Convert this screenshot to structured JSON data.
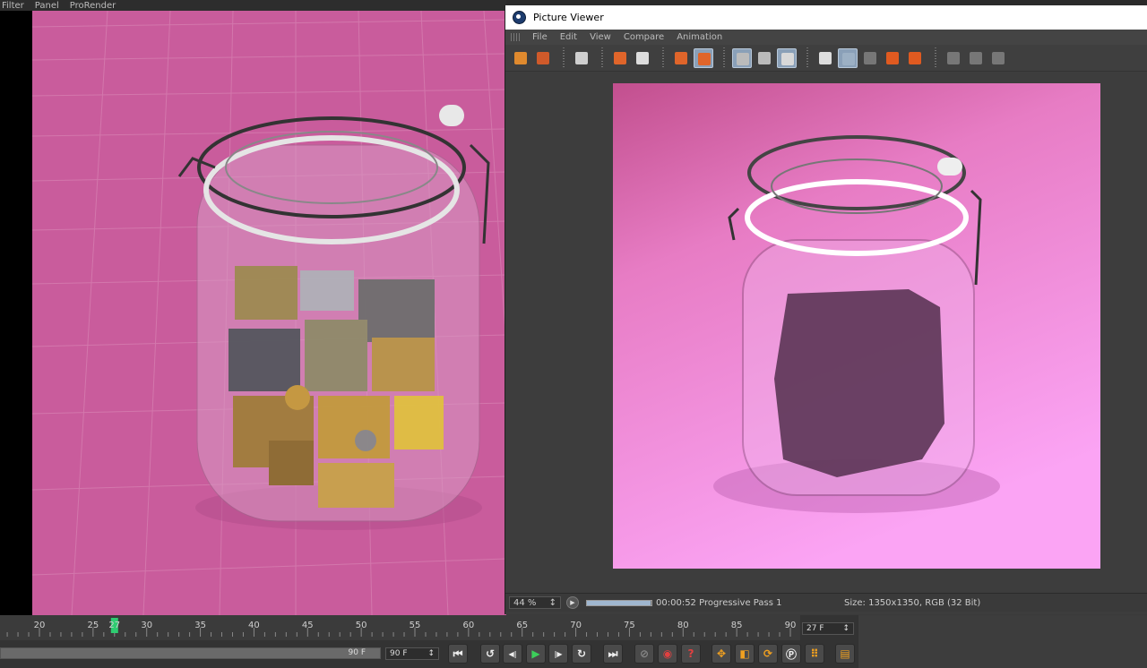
{
  "left_menu": [
    "Filter",
    "Panel",
    "ProRender"
  ],
  "picture_viewer": {
    "title": "Picture Viewer",
    "menu": [
      "File",
      "Edit",
      "View",
      "Compare",
      "Animation"
    ],
    "status": {
      "zoom": "44 %",
      "progress_fraction": 0.98,
      "progress_text": "00:00:52 Progressive Pass 1",
      "size_text": "Size: 1350x1350, RGB (32 Bit)"
    }
  },
  "timeline": {
    "ticks": [
      "20",
      "25",
      "27",
      "30",
      "35",
      "40",
      "45",
      "50",
      "55",
      "60",
      "65",
      "70",
      "75",
      "80",
      "85",
      "90"
    ],
    "current_frame": "27 F",
    "range_end": "90 F",
    "end_frame": "90 F"
  },
  "colors": {
    "viewport_bg": "#c95c9c",
    "render_bg": "#f2a0e8",
    "accent": "#2ecc71"
  },
  "icons": {
    "play": "▶",
    "prev_key": "◀|",
    "next_key": "|▶"
  }
}
